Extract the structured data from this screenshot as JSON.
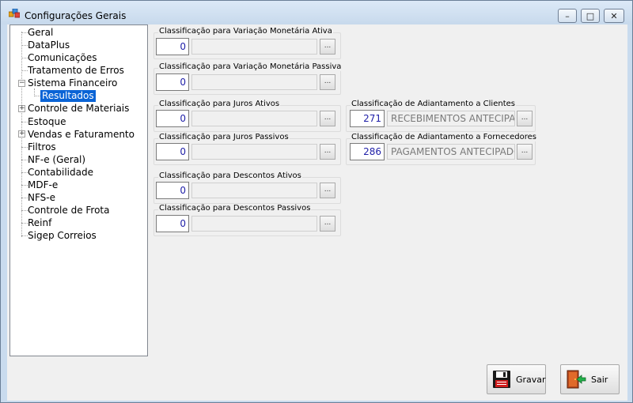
{
  "window": {
    "title": "Configurações Gerais",
    "app_icon": "app-icon",
    "buttons": {
      "minimize": "–",
      "maximize": "□",
      "close": "✕"
    }
  },
  "tree": {
    "items": [
      {
        "label": "Geral"
      },
      {
        "label": "DataPlus"
      },
      {
        "label": "Comunicações"
      },
      {
        "label": "Tratamento de Erros"
      },
      {
        "label": "Sistema Financeiro",
        "expander": "−"
      },
      {
        "label": "Resultados",
        "selected": true
      },
      {
        "label": "Controle de Materiais",
        "expander": "+"
      },
      {
        "label": "Estoque"
      },
      {
        "label": "Vendas e Faturamento",
        "expander": "+"
      },
      {
        "label": "Filtros"
      },
      {
        "label": "NF-e (Geral)"
      },
      {
        "label": "Contabilidade"
      },
      {
        "label": "MDF-e"
      },
      {
        "label": "NFS-e"
      },
      {
        "label": "Controle de Frota"
      },
      {
        "label": "Reinf"
      },
      {
        "label": "Sigep Correios"
      }
    ]
  },
  "fields": {
    "variacao_ativa": {
      "label": "Classificação para Variação Monetária Ativa",
      "code": "0",
      "description": "",
      "button": "..."
    },
    "variacao_passiva": {
      "label": "Classificação para Variação Monetária Passiva",
      "code": "0",
      "description": "",
      "button": "..."
    },
    "juros_ativos": {
      "label": "Classificação para Juros Ativos",
      "code": "0",
      "description": "",
      "button": "..."
    },
    "juros_passivos": {
      "label": "Classificação para Juros Passivos",
      "code": "0",
      "description": "",
      "button": "..."
    },
    "descontos_ativos": {
      "label": "Classificação para Descontos Ativos",
      "code": "0",
      "description": "",
      "button": "..."
    },
    "descontos_passivos": {
      "label": "Classificação para Descontos Passivos",
      "code": "0",
      "description": "",
      "button": "..."
    },
    "adiant_clientes": {
      "label": "Classificação de Adiantamento a Clientes",
      "code": "271",
      "description": "RECEBIMENTOS ANTECIPAD",
      "button": "..."
    },
    "adiant_fornecedores": {
      "label": "Classificação de Adiantamento a Fornecedores",
      "code": "286",
      "description": "PAGAMENTOS ANTECIPADO",
      "button": "..."
    }
  },
  "actions": {
    "save": {
      "label": "Gravar",
      "icon": "floppy-disk-icon"
    },
    "exit": {
      "label": "Sair",
      "icon": "exit-door-icon"
    }
  },
  "colors": {
    "selection": "#0a64d6",
    "code_text": "#1f1fa8",
    "window_frame": "#c9dbee"
  }
}
